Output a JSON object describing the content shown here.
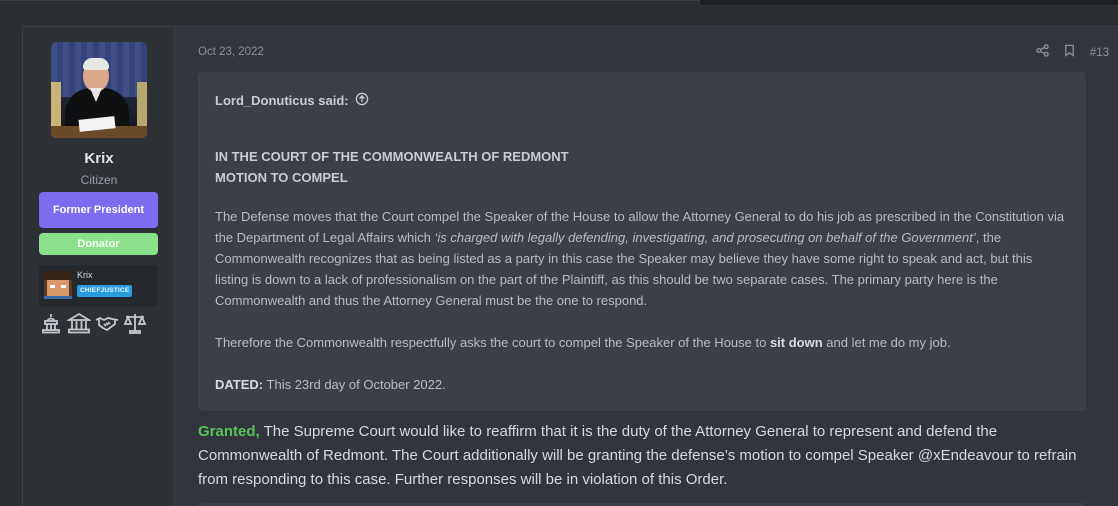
{
  "post": {
    "date": "Oct 23, 2022",
    "number": "#13",
    "author": {
      "name": "Krix",
      "title": "Citizen",
      "banners": [
        "Former President",
        "Donator"
      ],
      "mini_profile": {
        "name": "Krix",
        "badge": "CHIEFJUSTICE"
      },
      "trophy_icons": [
        "capitol-icon",
        "courthouse-icon",
        "handshake-icon",
        "scales-icon"
      ]
    },
    "quote": {
      "author": "Lord_Donuticus said:",
      "heading_line1": "IN THE COURT OF THE COMMONWEALTH OF REDMONT",
      "heading_line2": "MOTION TO COMPEL",
      "p1_start": "The Defense moves that the Court compel the Speaker of the House to allow the Attorney General to do his job as prescribed in the Constitution via the Department of Legal Affairs which ",
      "p1_italic": "‘is charged with legally defending, investigating, and prosecuting on behalf of the Government’",
      "p1_end": ", the Commonwealth recognizes that as being listed as a party in this case the Speaker may believe they have some right to speak and act, but this listing is down to a lack of professionalism on the part of the Plaintiff, as this should be two separate cases. The primary party here is the Commonwealth and thus the Attorney General must be the one to respond.",
      "p2_start": "Therefore the Commonwealth respectfully asks the court to compel the Speaker of the House to ",
      "p2_bold": "sit down",
      "p2_end": " and let me do my job.",
      "dated_label": "DATED:",
      "dated_value": " This 23rd day of October 2022."
    },
    "body": {
      "granted": "Granted,",
      "text": " The Supreme Court would like to reaffirm that it is the duty of the Attorney General to represent and defend the Commonwealth of Redmont. The Court additionally will be granting the defense’s motion to compel Speaker @xEndeavour to refrain from responding to this case. Further responses will be in violation of this Order."
    },
    "colors": {
      "president_banner": "#7b6cf0",
      "donator_banner": "#8ce08c",
      "granted": "#57c25a",
      "badge": "#2b9be0"
    }
  }
}
